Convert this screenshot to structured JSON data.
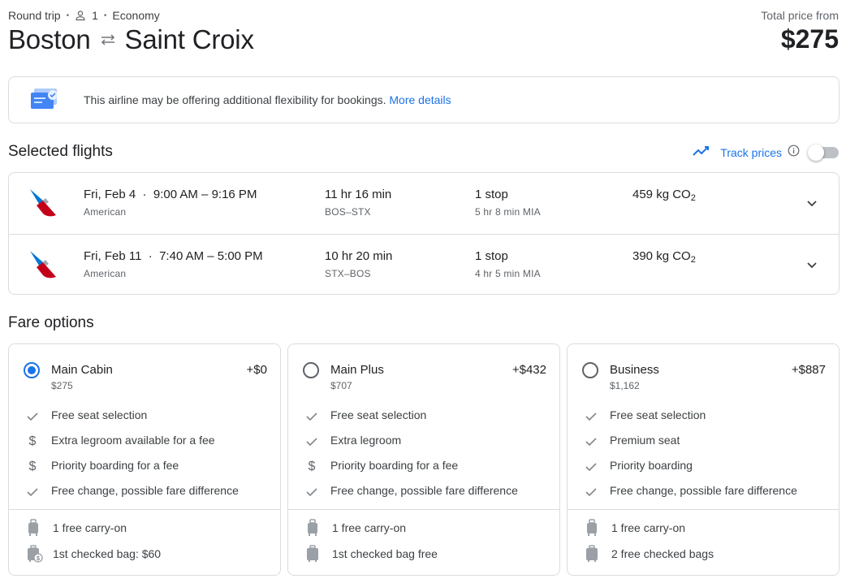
{
  "header": {
    "trip_type": "Round trip",
    "passengers": "1",
    "cabin": "Economy",
    "origin": "Boston",
    "destination": "Saint Croix",
    "total_label": "Total price from",
    "total_price": "$275"
  },
  "banner": {
    "text": "This airline may be offering additional flexibility for bookings.",
    "link": "More details"
  },
  "selected_flights": {
    "heading": "Selected flights",
    "track_label": "Track prices",
    "flights": [
      {
        "date": "Fri, Feb 4",
        "times": "9:00 AM – 9:16 PM",
        "airline": "American",
        "duration": "11 hr 16 min",
        "route": "BOS–STX",
        "stops": "1 stop",
        "layover": "5 hr 8 min MIA",
        "co2": "459 kg CO",
        "co2_sub": "2"
      },
      {
        "date": "Fri, Feb 11",
        "times": "7:40 AM – 5:00 PM",
        "airline": "American",
        "duration": "10 hr 20 min",
        "route": "STX–BOS",
        "stops": "1 stop",
        "layover": "4 hr 5 min MIA",
        "co2": "390 kg CO",
        "co2_sub": "2"
      }
    ]
  },
  "fare_options": {
    "heading": "Fare options",
    "fares": [
      {
        "name": "Main Cabin",
        "price": "$275",
        "diff": "+$0",
        "selected": true,
        "features": [
          {
            "icon": "check-icon",
            "text": "Free seat selection"
          },
          {
            "icon": "dollar-icon",
            "text": "Extra legroom available for a fee"
          },
          {
            "icon": "dollar-icon",
            "text": "Priority boarding for a fee"
          },
          {
            "icon": "check-icon",
            "text": "Free change, possible fare difference"
          }
        ],
        "bags": [
          {
            "icon": "carry-on-icon",
            "text": "1 free carry-on"
          },
          {
            "icon": "checked-bag-fee-icon",
            "text": "1st checked bag: $60"
          }
        ]
      },
      {
        "name": "Main Plus",
        "price": "$707",
        "diff": "+$432",
        "selected": false,
        "features": [
          {
            "icon": "check-icon",
            "text": "Free seat selection"
          },
          {
            "icon": "check-icon",
            "text": "Extra legroom"
          },
          {
            "icon": "dollar-icon",
            "text": "Priority boarding for a fee"
          },
          {
            "icon": "check-icon",
            "text": "Free change, possible fare difference"
          }
        ],
        "bags": [
          {
            "icon": "carry-on-icon",
            "text": "1 free carry-on"
          },
          {
            "icon": "checked-bag-icon",
            "text": "1st checked bag free"
          }
        ]
      },
      {
        "name": "Business",
        "price": "$1,162",
        "diff": "+$887",
        "selected": false,
        "features": [
          {
            "icon": "check-icon",
            "text": "Free seat selection"
          },
          {
            "icon": "check-icon",
            "text": "Premium seat"
          },
          {
            "icon": "check-icon",
            "text": "Priority boarding"
          },
          {
            "icon": "check-icon",
            "text": "Free change, possible fare difference"
          }
        ],
        "bags": [
          {
            "icon": "carry-on-icon",
            "text": "1 free carry-on"
          },
          {
            "icon": "checked-bag-icon",
            "text": "2 free checked bags"
          }
        ]
      }
    ]
  },
  "colors": {
    "accent": "#1a73e8",
    "text": "#202124",
    "secondary": "#5f6368",
    "border": "#dadce0"
  }
}
